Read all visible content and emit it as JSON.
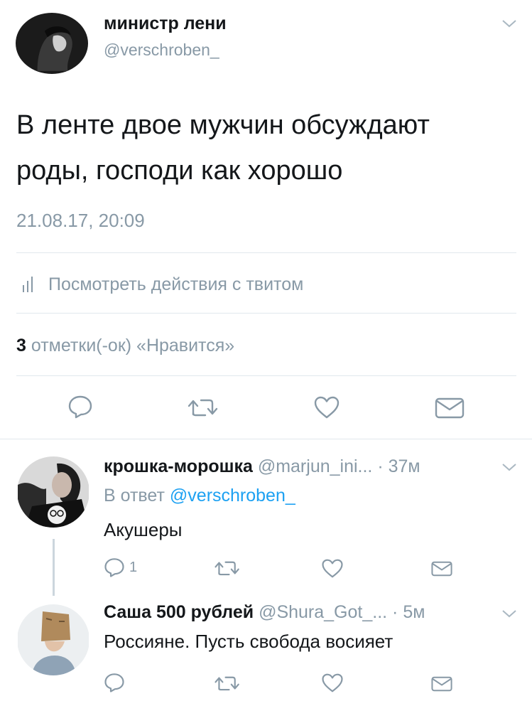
{
  "tweet": {
    "author_name": "министр лени",
    "author_handle": "@verschroben_",
    "text_line1": "В ленте двое мужчин обсуждают",
    "text_line2": "роды, господи как хорошо",
    "timestamp": "21.08.17, 20:09",
    "activity_label": "Посмотреть действия с твитом",
    "likes_count": "3",
    "likes_label": "отметки(-ок) «Нравится»"
  },
  "replies": [
    {
      "name": "крошка-морошка",
      "handle": "@marjun_ini...",
      "time": "· 37м",
      "in_reply_prefix": "В ответ",
      "in_reply_handle": "@verschroben_",
      "text": "Акушеры",
      "reply_count": "1"
    },
    {
      "name": "Саша 500 рублей",
      "handle": "@Shura_Got_...",
      "time": "· 5м",
      "text": "Россияне. Пусть свобода восияет"
    }
  ],
  "icons": {
    "reply": "speech-bubble-icon",
    "retweet": "retweet-arrows-icon",
    "like": "heart-icon",
    "dm": "envelope-icon",
    "stats": "bar-chart-icon",
    "caret": "chevron-down-icon"
  },
  "colors": {
    "accent": "#1da1f2",
    "secondary_text": "#8899a6",
    "divider": "#e1e8ed"
  }
}
